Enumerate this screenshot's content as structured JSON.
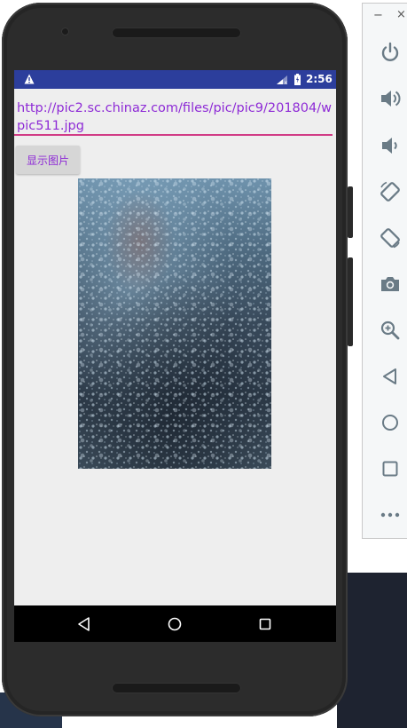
{
  "emulator": {
    "panel": {
      "minimize_label": "−",
      "close_label": "×",
      "buttons": [
        {
          "icon": "power-icon"
        },
        {
          "icon": "volume-up-icon"
        },
        {
          "icon": "volume-down-icon"
        },
        {
          "icon": "rotate-left-icon"
        },
        {
          "icon": "rotate-right-icon"
        },
        {
          "icon": "camera-icon"
        },
        {
          "icon": "zoom-icon"
        },
        {
          "icon": "back-icon"
        },
        {
          "icon": "home-icon"
        },
        {
          "icon": "overview-icon"
        },
        {
          "icon": "more-icon"
        }
      ]
    }
  },
  "device": {
    "status_bar": {
      "time": "2:56",
      "color": "#2c3e9c"
    },
    "app": {
      "url_input": {
        "value": "http://pic2.sc.chinaz.com/files/pic/pic9/201804/wpic511.jpg",
        "underline_color": "#d13c86",
        "text_color": "#8e2bd6"
      },
      "show_button": {
        "label": "显示图片"
      },
      "image": {
        "icon": "raindrops-photo"
      }
    },
    "nav_bar": {
      "buttons": [
        "back-icon",
        "home-icon",
        "recents-icon"
      ]
    }
  }
}
